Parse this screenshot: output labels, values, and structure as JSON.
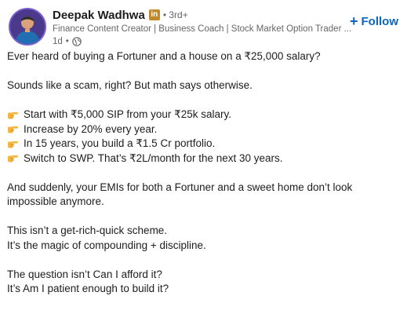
{
  "post": {
    "author": {
      "name": "Deepak Wadhwa",
      "badge": "in",
      "connection_degree": "• 3rd+",
      "headline": "Finance Content Creator | Business Coach | Stock Market Option Trader ...",
      "time_ago": "1d",
      "visibility_icon": "globe-icon"
    },
    "follow_button": {
      "plus": "+",
      "label": "Follow"
    },
    "body": {
      "intro": "Ever heard of buying a Fortuner and a house on a ₹25,000 salary?",
      "hook": "Sounds like a scam, right? But math says otherwise.",
      "bullets": [
        "Start with ₹5,000 SIP from your ₹25k salary.",
        "Increase by 20% every year.",
        "In 15 years, you build a ₹1.5 Cr portfolio.",
        "Switch to SWP. That’s ₹2L/month for the next 30 years."
      ],
      "bullet_icon": "pointing-hand-icon",
      "conclusion": "And suddenly, your EMIs for both a Fortuner and a sweet home don’t look impossible anymore.",
      "scheme_line1": "This isn’t a get-rich-quick scheme.",
      "scheme_line2": "It’s the magic of compounding + discipline.",
      "question_line1": "The question isn’t Can I afford it?",
      "question_line2": "It’s Am I patient enough to build it?"
    },
    "colors": {
      "follow": "#0a66c2",
      "text": "#1d1d1d",
      "muted": "#666666",
      "badge": "#c08a2c"
    }
  }
}
